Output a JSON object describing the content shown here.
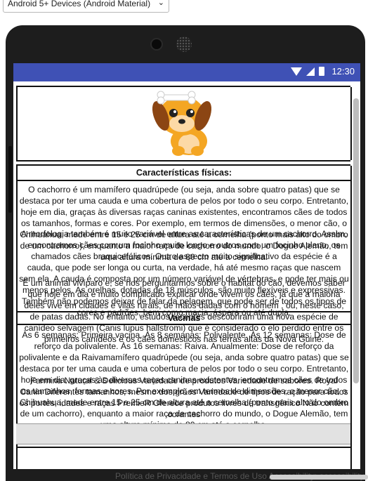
{
  "device_select": {
    "value": "Android 5+ Devices (Android Material)"
  },
  "status_bar": {
    "time": "12:30"
  },
  "sections": {
    "caracteristicas_heading": "Características físicas:",
    "caracteristicas_text": "O cachorro é um mamífero quadrúpede (ou seja, anda sobre quatro patas) que se destaca por ter uma cauda e uma cobertura de pelos por todo o seu corpo. Entretanto, hoje em dia, graças às diversas raças caninas existentes, encontramos cães de todos os tamanhos, formas e cores. Por exemplo, em termos de dimensões, o menor cão, o Chihuahua, mede entre 15 e 25 cm de altura até a cernelha (ponto mais alto do ombro de um cachorro), enquanto a maior raça de cachorro do mundo, o Dogue Alemão, tem uma altura mínima de 80 cm até a cernelha.",
    "morfologia_text": "A morfologia também é muito variável entre as características de um cachorro. Assim, encontramos cães com um focinho muito longo e outros com um focinho plano, os chamados cães braquicefálicos. Outro aspecto muito significativo da espécie é a cauda, que pode ser longa ou curta, na verdade, há até mesmo raças que nascem sem ela. A cauda é composta por um número variável de vértebras, e pode ter mais ou menos pelos. As orelhas, dotadas de 18 músculos, são muito flexíveis e expressivas. Também não podemos deixar de falar da pelagem, que pode ser de todos os tipos de cores e padrões, bem como macia, áspera ou até dupla.",
    "habitat_text": "É um animal vivíparo e, se nos perguntarmos sobre o habitat do cão, devemos saber que hoje em dia é muito complicado explicar onde vivem os cães, já que a maioria deles vive em cidades e vilas rurais, de mãos dadas com o homem , ou, neste caso, de patas dadas. No entanto, estudos recentes descobriram uma nova espécie de canídeo selvagem (Canis lupus hallstromi) que é considerado o elo perdido entre os primeiros canídeos e os cães domésticos nas terras altas da Nova Guiné.",
    "vacinas_heading": "Vacinas",
    "vacinas_text": "Às 6 semanas: Primeira vacina. Às 8 semanas: Polivalente. Às 12 semanas: Dose de reforço da polivalente. Às 16 semanas: Raiva. Anualmente: Dose de reforço da polivalente e da Raivamamífero quadrúpede (ou seja, anda sobre quatro patas) que se destaca por ter uma cauda e uma cobertura de pelos por todo o seu corpo. Entretanto, hoje em dia, graças às diversas raças caninas existentes, encontramos cães de todos os tamanhos, formas e cores. Por exemplo, em termos de dimensões, o menor cão, o Chihuahua, mede entre 15 e 25 cm de altura até a cernelha (ponto mais alto do ombro de um cachorro), enquanto a maior raça de cachorro do mundo, o Dogue Alemão, tem uma altura mínima de 80 cm até a cernelha.",
    "racao_text": "Farmina Natural & Delicious Variedade de produtos Variedade de sabores. Royal Canin Diferentes tamanhos, mesmo dos grãos Variedade de tipos de ração para todos os portes, idades e raças PremieR Oferece produtos livres de transgênico Não contém corantes"
  },
  "footer": {
    "text": "Política de Privacidade e Termos de Uso      Accessibility: accessibility"
  },
  "colors": {
    "status_bar": "#3f51b5",
    "phone": "#1d1d1d"
  },
  "icons": [
    "wifi-icon",
    "signal-icon",
    "battery-icon",
    "dog-image"
  ]
}
